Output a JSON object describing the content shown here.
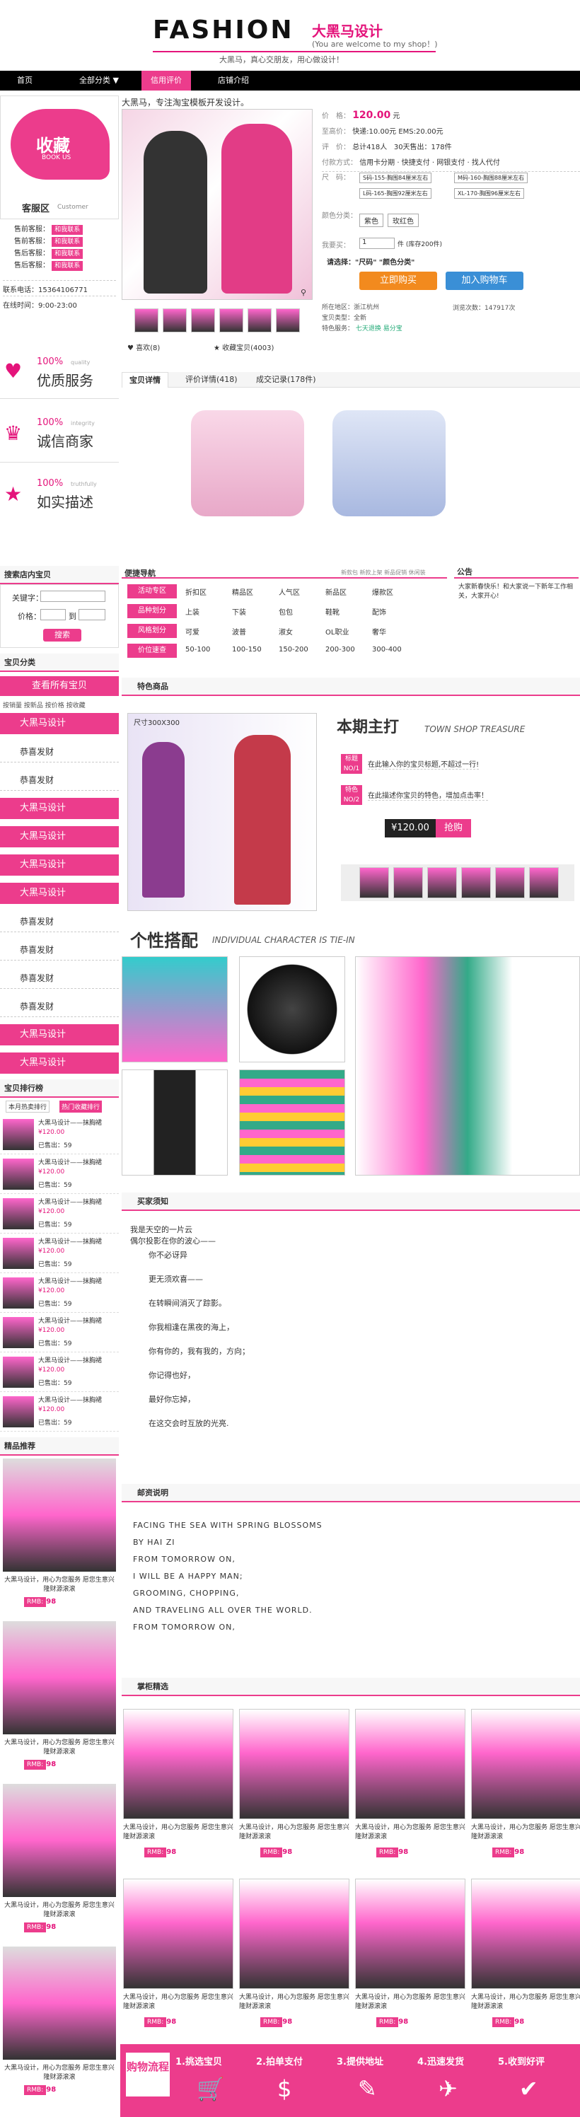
{
  "header": {
    "logo": "FASHION",
    "logo_cn": "大黑马设计",
    "logo_en": "(You are welcome to my shop！)",
    "slogan": "大黑马，真心交朋友，用心做设计！"
  },
  "nav": {
    "items": [
      "首页",
      "全部分类",
      "信用评价",
      "店铺介绍"
    ]
  },
  "side": {
    "fav_title": "收藏",
    "fav_sub": "BOOK US",
    "cs_title": "客服区",
    "cs_sub": "Customer",
    "cs_items": [
      "售前客服：",
      "售前客服：",
      "售后客服：",
      "售后客服："
    ],
    "cs_tag": "和我联系",
    "phone": "联系电话：15364106771",
    "hours": "在线时间：9:00-23:00",
    "promises": [
      {
        "pct": "100%",
        "en": "quality",
        "cn": "优质服务"
      },
      {
        "pct": "100%",
        "en": "integrity",
        "cn": "诚信商家"
      },
      {
        "pct": "100%",
        "en": "truthfully",
        "cn": "如实描述"
      }
    ],
    "search": {
      "title": "搜索店内宝贝",
      "kw": "关键字：",
      "price": "价格：",
      "to": "到",
      "btn": "搜索"
    },
    "cat": {
      "title": "宝贝分类",
      "all": "查看所有宝贝",
      "sorts": "按销量 按新品 按价格 按收藏",
      "items": [
        {
          "t": "大黑马设计",
          "p": true
        },
        {
          "t": "恭喜发财",
          "p": false
        },
        {
          "t": "恭喜发财",
          "p": false
        },
        {
          "t": "大黑马设计",
          "p": true
        },
        {
          "t": "大黑马设计",
          "p": true
        },
        {
          "t": "大黑马设计",
          "p": true
        },
        {
          "t": "大黑马设计",
          "p": true
        },
        {
          "t": "恭喜发财",
          "p": false
        },
        {
          "t": "恭喜发财",
          "p": false
        },
        {
          "t": "恭喜发财",
          "p": false
        },
        {
          "t": "恭喜发财",
          "p": false
        },
        {
          "t": "大黑马设计",
          "p": true
        },
        {
          "t": "大黑马设计",
          "p": true
        }
      ]
    },
    "rank": {
      "title": "宝贝排行榜",
      "tab1": "本月热卖排行",
      "tab2": "热门收藏排行",
      "name": "大黑马设计——抹胸裙",
      "price": "¥120.00",
      "sold": "已售出：59"
    },
    "rec": {
      "title": "精品推荐",
      "cap": "大黑马设计，用心为您服务 愿您生意兴隆财源滚滚",
      "rmb": "RMB:",
      "price": "98"
    }
  },
  "product": {
    "title": "大黑马，专注淘宝模板开发设计。",
    "price_label": "价　格：",
    "price": "120.00",
    "price_unit": "元",
    "promo_label": "至高价：",
    "promo": "快递:10.00元 EMS:20.00元",
    "review_label": "评　价：",
    "review": "总计418人",
    "sales": "30天售出：178件",
    "pay_label": "付款方式：",
    "pay": [
      "信用卡分期",
      "快捷支付",
      "网银支付",
      "找人代付"
    ],
    "size_label": "尺　码：",
    "sizes": [
      "S码-155-胸围84厘米左右",
      "M码-160-胸围88厘米左右",
      "L码-165-胸围92厘米左右",
      "XL-170-胸围96厘米左右"
    ],
    "color_label": "颜色分类：",
    "colors": [
      "紫色",
      "玫红色"
    ],
    "qty_label": "我要买：",
    "qty": "1",
    "stock": "件 (库存200件)",
    "choose": "请选择：\"尺码\" \"颜色分类\"",
    "buy": "立即购买",
    "cart": "加入购物车",
    "loc": "所在地区：浙江杭州",
    "views": "浏览次数：147917次",
    "cond": "宝贝类型：全新",
    "svc": [
      "七天退换",
      "易分宝"
    ],
    "svc_label": "特色服务：",
    "like": "喜欢",
    "like_n": "(8)",
    "fav": "收藏宝贝",
    "fav_n": "(4003)",
    "tabs": [
      "宝贝详情",
      "评价详情(418)",
      "成交记录(178件)"
    ]
  },
  "quick": {
    "title": "便捷导航",
    "links": "新款包 新款上架 新品促销 休闲装",
    "rows": [
      {
        "h": "活动专区",
        "c": [
          "折扣区",
          "精品区",
          "人气区",
          "新品区",
          "爆款区"
        ]
      },
      {
        "h": "品种划分",
        "c": [
          "上装",
          "下装",
          "包包",
          "鞋靴",
          "配饰"
        ]
      },
      {
        "h": "风格划分",
        "c": [
          "可爱",
          "波普",
          "淑女",
          "OL职业",
          "奢华"
        ]
      },
      {
        "h": "价位速查",
        "c": [
          "50-100",
          "100-150",
          "150-200",
          "200-300",
          "300-400"
        ]
      }
    ]
  },
  "notice": {
    "title": "公告",
    "text": "大家新春快乐！和大家说一下新年工作相关，大家开心!"
  },
  "feature": {
    "title": "特色商品",
    "size": "尺寸300X300",
    "head_cn": "本期主打",
    "head_en": "TOWN SHOP TREASURE",
    "tip1_tag": "标题",
    "tip1_no": "NO/1",
    "tip1": "在此输入你的宝贝标题,不超过一行!",
    "tip2_tag": "特色",
    "tip2_no": "NO/2",
    "tip2": "在此描述你宝贝的特色，增加点击率！",
    "price": "¥120.00",
    "buy": "抢购"
  },
  "style": {
    "head_cn": "个性搭配",
    "head_en": "INDIVIDUAL CHARACTER IS TIE-IN"
  },
  "buyer": {
    "title": "买家须知",
    "lines": [
      "我是天空的一片云",
      "偶尔投影在你的波心——",
      "你不必讶异",
      "更无须欢喜——",
      "在转瞬间消灭了踪影。",
      "你我相逢在黑夜的海上，",
      "你有你的，我有我的，方向；",
      "你记得也好，",
      "最好你忘掉，",
      "在这交会时互放的光亮."
    ]
  },
  "mail": {
    "title": "邮资说明",
    "lines": [
      "FACING THE SEA WITH SPRING BLOSSOMS",
      "BY HAI ZI",
      "FROM TOMORROW ON,",
      "I WILL BE A HAPPY MAN;",
      "GROOMING, CHOPPING,",
      "AND TRAVELING ALL OVER THE WORLD.",
      "FROM TOMORROW ON,"
    ]
  },
  "picks": {
    "title": "掌柜精选",
    "cap": "大黑马设计，用心为您服务 愿您生意兴隆财源滚滚",
    "rmb": "RMB:",
    "price": "98"
  },
  "flow": {
    "title": "购物流程",
    "steps": [
      "1.挑选宝贝",
      "2.拍单支付",
      "3.提供地址",
      "4.迅速发货",
      "5.收到好评"
    ]
  },
  "colors": {
    "accent": "#ec3c8c",
    "dark": "#000000"
  }
}
